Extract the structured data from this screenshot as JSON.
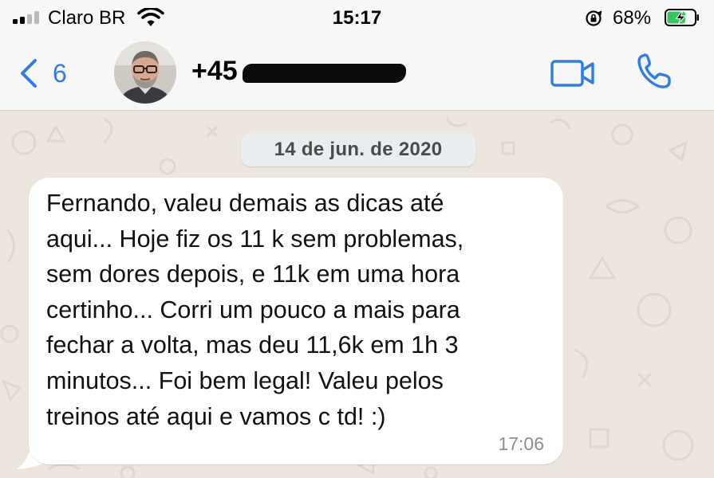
{
  "status_bar": {
    "carrier": "Claro BR",
    "time": "15:17",
    "battery_percent": "68%",
    "signal_bars": 2,
    "battery_level": 0.68,
    "charging": true
  },
  "header": {
    "back_count": "6",
    "contact_prefix": "+45",
    "contact_redacted": true,
    "icons": [
      "chevron-left-icon",
      "video-camera-icon",
      "phone-icon"
    ],
    "accent_color": "#2f7de1"
  },
  "chat": {
    "date_label": "14 de jun. de 2020",
    "messages": [
      {
        "direction": "incoming",
        "text": "Fernando, valeu demais as dicas até\naqui... Hoje fiz os 11 k sem problemas,\nsem dores depois, e 11k em uma hora\ncertinho... Corri um pouco a mais para\nfechar a volta, mas deu 11,6k em 1h 3\nminutos... Foi bem legal! Valeu pelos\ntreinos até aqui e vamos c td! :)",
        "time": "17:06"
      }
    ],
    "background_color": "#ece5dd",
    "bubble_color": "#ffffff"
  }
}
